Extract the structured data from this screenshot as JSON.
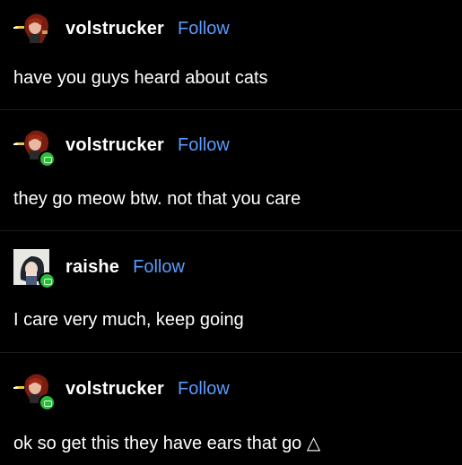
{
  "posts": [
    {
      "username": "volstrucker",
      "follow_label": "Follow",
      "text": "have you guys heard about cats",
      "avatar": "red-haired-character-icon",
      "badge": false
    },
    {
      "username": "volstrucker",
      "follow_label": "Follow",
      "text": "they go meow btw. not that you care",
      "avatar": "red-haired-character-icon",
      "badge": true
    },
    {
      "username": "raishe",
      "follow_label": "Follow",
      "text": "I care very much, keep going",
      "avatar": "anime-character-icon",
      "badge": true
    },
    {
      "username": "volstrucker",
      "follow_label": "Follow",
      "text": "ok so get this they have ears that go △",
      "avatar": "red-haired-character-icon",
      "badge": true
    }
  ],
  "colors": {
    "background": "#000000",
    "text": "#ffffff",
    "follow": "#5a9bff",
    "badge": "#2bbd3a"
  }
}
